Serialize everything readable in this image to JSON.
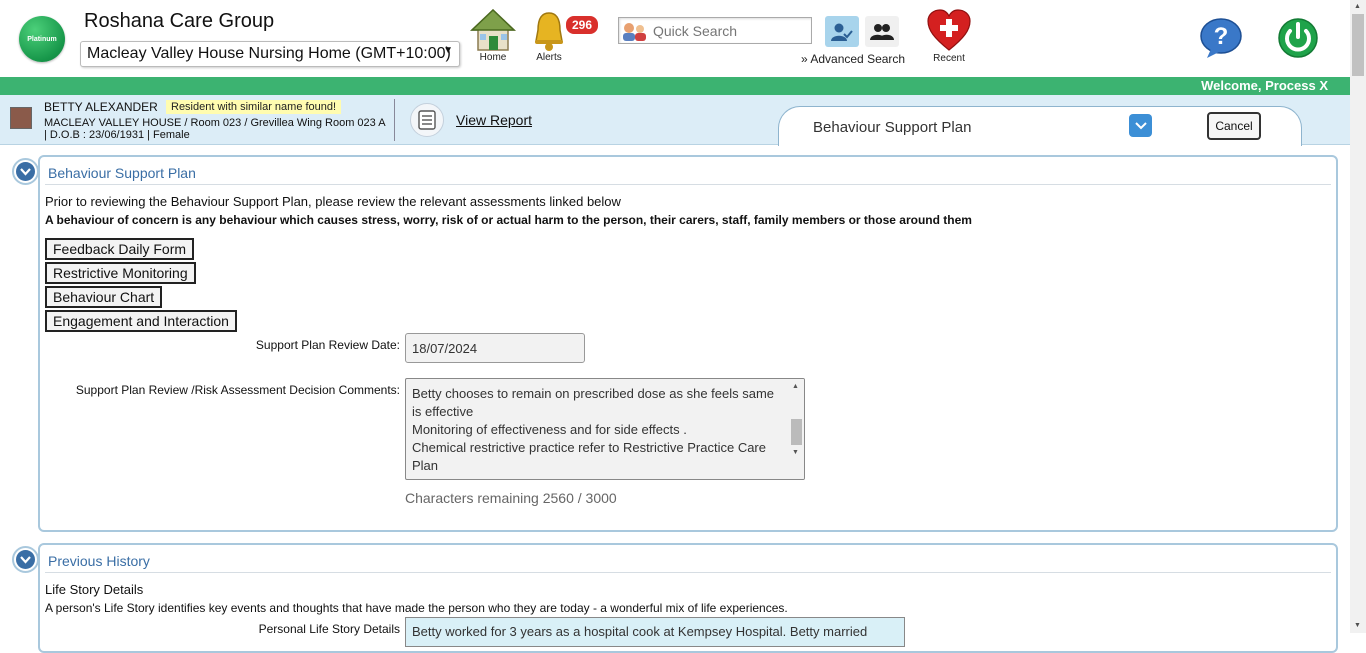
{
  "header": {
    "logo_text": "Platinum",
    "org_name": "Roshana Care Group",
    "facility": "Macleay Valley House Nursing Home (GMT+10:00)",
    "nav": {
      "home_label": "Home",
      "alerts_label": "Alerts",
      "alerts_count": "296",
      "recent_label": "Recent"
    },
    "search": {
      "placeholder": "Quick Search",
      "advanced_label": "Advanced Search"
    },
    "welcome": "Welcome, Process X"
  },
  "resident": {
    "name": "BETTY ALEXANDER",
    "warning": "Resident with similar name found!",
    "location": "MACLEAY VALLEY HOUSE / Room 023 / Grevillea Wing Room 023 A",
    "details": "| D.O.B : 23/06/1931 | Female",
    "view_report": "View Report"
  },
  "form_tab": {
    "title": "Behaviour Support Plan",
    "cancel_label": "Cancel"
  },
  "section_bsp": {
    "title": "Behaviour Support Plan",
    "intro": "Prior to reviewing the Behaviour Support Plan, please review the relevant assessments linked below",
    "definition": "A behaviour of concern is any behaviour which causes stress, worry, risk of or actual harm to the person, their carers, staff, family members or those around them",
    "links": [
      "Feedback Daily Form",
      "Restrictive Monitoring",
      "Behaviour Chart",
      "Engagement and Interaction"
    ],
    "review_date_label": "Support Plan Review Date:",
    "review_date_value": "18/07/2024",
    "comments_label": "Support Plan Review /Risk Assessment Decision Comments:",
    "comments_lines": [
      "Betty chooses to remain on prescribed dose as she feels same",
      "is effective",
      "Monitoring of effectiveness and for side effects .",
      "Chemical restrictive practice refer to Restrictive Practice Care",
      "Plan"
    ],
    "chars_remaining": "Characters remaining 2560 / 3000"
  },
  "section_history": {
    "title": "Previous History",
    "subheading": "Life Story Details",
    "description": "A person's Life Story identifies key events and thoughts that have made the person who they are today - a wonderful mix of life experiences.",
    "life_story_label": "Personal Life Story Details",
    "life_story_value": "Betty worked for 3 years as a hospital cook at Kempsey Hospital. Betty married"
  },
  "colors": {
    "brand_green": "#3cb371",
    "section_blue": "#3a6ea5",
    "alert_red": "#d9302c"
  }
}
